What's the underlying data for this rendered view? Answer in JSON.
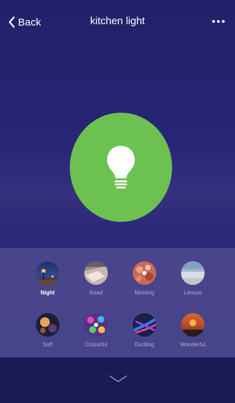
{
  "header": {
    "back_label": "Back",
    "title": "kitchen light",
    "more_icon": "more-horizontal-icon"
  },
  "main": {
    "bulb_icon": "lightbulb-icon",
    "power_color": "#6cc150"
  },
  "scenes": {
    "items": [
      {
        "label": "Night",
        "selected": true
      },
      {
        "label": "Read",
        "selected": false
      },
      {
        "label": "Meeting",
        "selected": false
      },
      {
        "label": "Leisure",
        "selected": false
      },
      {
        "label": "Soft",
        "selected": false
      },
      {
        "label": "Colourful",
        "selected": false
      },
      {
        "label": "Exciting",
        "selected": false
      },
      {
        "label": "Wonderful",
        "selected": false
      }
    ]
  },
  "footer": {
    "collapse_icon": "chevron-down-icon"
  }
}
